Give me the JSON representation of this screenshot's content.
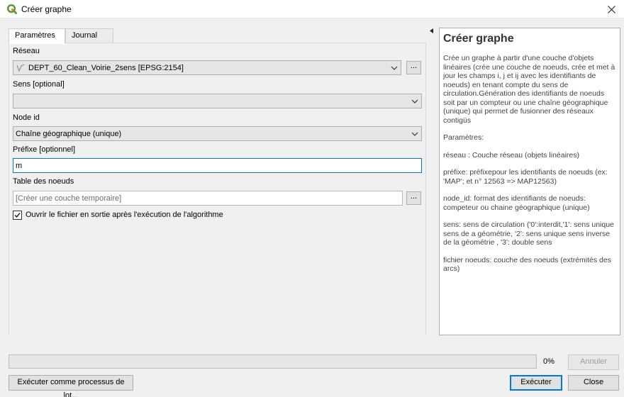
{
  "window": {
    "title": "Créer graphe",
    "icon": "qgis-logo-icon"
  },
  "tabs": [
    {
      "label": "Paramètres",
      "active": true
    },
    {
      "label": "Journal",
      "active": false
    }
  ],
  "form": {
    "reseau": {
      "label": "Réseau",
      "value": "DEPT_60_Clean_Voirie_2sens [EPSG:2154]",
      "button": "..."
    },
    "sens": {
      "label": "Sens [optional]",
      "value": ""
    },
    "node_id": {
      "label": "Node id",
      "value": "Chaîne géographique (unique)"
    },
    "prefixe": {
      "label": "Préfixe [optionnel]",
      "value": "m"
    },
    "table_noeuds": {
      "label": "Table des noeuds",
      "placeholder": "[Créer une couche temporaire]",
      "button": "..."
    },
    "open_output": {
      "label": "Ouvrir le fichier en sortie après l'exécution de l'algorithme",
      "checked": true
    }
  },
  "help": {
    "title": "Créer graphe",
    "paragraphs": [
      "Crée un graphe à partir d'une couche d'objets linéaires (crée une couche de noeuds, crée et met à jour les champs i, j et ij avec les identifiants de noeuds) en tenant compte du sens de circulation.Génération des identifiants de noeuds soit par un compteur ou une chaîne géographique (unique) qui permet de fusionner des réseaux contigüs",
      "Paramètres:",
      "réseau : Couche réseau (objets linéaires)",
      "préfixe: préfixepour les identifiants de noeuds (ex: 'MAP'; et n° 12563 => MAP12563)",
      "node_id: format des identifiants de noeuds: competeur ou chaine géographique (unique)",
      "sens: sens de circulation ('0':interdit,'1': sens unique sens de a géométrie, '2': sens unique sens inverse de la géométrie , '3': double sens",
      "fichier noeuds: couche des noeuds (extrémités des arcs)"
    ]
  },
  "progress": {
    "percent": 0,
    "label": "0%"
  },
  "buttons": {
    "cancel": "Annuler",
    "batch": "Exécuter comme processus de lot...",
    "run": "Exécuter",
    "close": "Close"
  },
  "colors": {
    "accent": "#0078d7",
    "qgis_green": "#589632",
    "qgis_yellow": "#ee7913"
  }
}
